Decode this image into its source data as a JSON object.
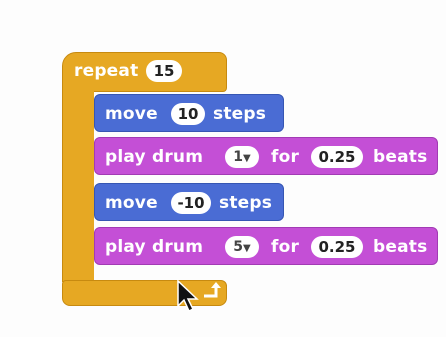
{
  "repeat": {
    "label": "repeat",
    "count": "15"
  },
  "blocks": [
    {
      "type": "motion",
      "text_before": "move",
      "value": "10",
      "text_after": "steps"
    },
    {
      "type": "sound",
      "text_before": "play drum",
      "drum": "1",
      "mid": "for",
      "value": "0.25",
      "text_after": "beats"
    },
    {
      "type": "motion",
      "text_before": "move",
      "value": "-10",
      "text_after": "steps"
    },
    {
      "type": "sound",
      "text_before": "play drum",
      "drum": "5",
      "mid": "for",
      "value": "0.25",
      "text_after": "beats"
    }
  ],
  "colors": {
    "control": "#e6a823",
    "motion": "#4a6cd4",
    "sound": "#c44fd6"
  },
  "icons": {
    "loop": "loop-arrow-icon",
    "cursor": "mouse-pointer-icon",
    "dropdown": "dropdown-arrow-icon"
  }
}
